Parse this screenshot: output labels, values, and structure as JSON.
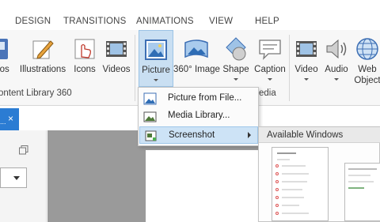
{
  "tabs": [
    "DESIGN",
    "TRANSITIONS",
    "ANIMATIONS",
    "VIEW",
    "HELP"
  ],
  "ribbon": {
    "buttons": [
      {
        "label": "otos",
        "icon": "photos-icon"
      },
      {
        "label": "Illustrations",
        "icon": "illustrations-icon"
      },
      {
        "label": "Icons",
        "icon": "icons-icon"
      },
      {
        "label": "Videos",
        "icon": "videos-icon"
      },
      {
        "label": "Picture",
        "icon": "picture-icon"
      },
      {
        "label": "360° Image",
        "icon": "image-360-icon"
      },
      {
        "label": "Shape",
        "icon": "shape-icon"
      },
      {
        "label": "Caption",
        "icon": "caption-icon"
      },
      {
        "label": "Video",
        "icon": "video-icon"
      },
      {
        "label": "Audio",
        "icon": "audio-icon"
      },
      {
        "label": "Web",
        "label2": "Object",
        "icon": "web-object-icon"
      }
    ],
    "group_labels": {
      "content_library": "ontent Library 360",
      "media": "edia"
    }
  },
  "menu": {
    "items": [
      {
        "label": "Picture from File...",
        "icon": "picture-file-icon"
      },
      {
        "label": "Media Library...",
        "icon": "media-library-icon"
      },
      {
        "label": "Screenshot",
        "icon": "screenshot-icon",
        "submenu": true
      }
    ]
  },
  "gallery": {
    "header": "Available Windows"
  },
  "pane": {
    "tab_dots": "...",
    "close": "×"
  },
  "colors": {
    "accent": "#2b7cd3",
    "hover": "#cde3f6",
    "canvas": "#9a9a9a"
  }
}
